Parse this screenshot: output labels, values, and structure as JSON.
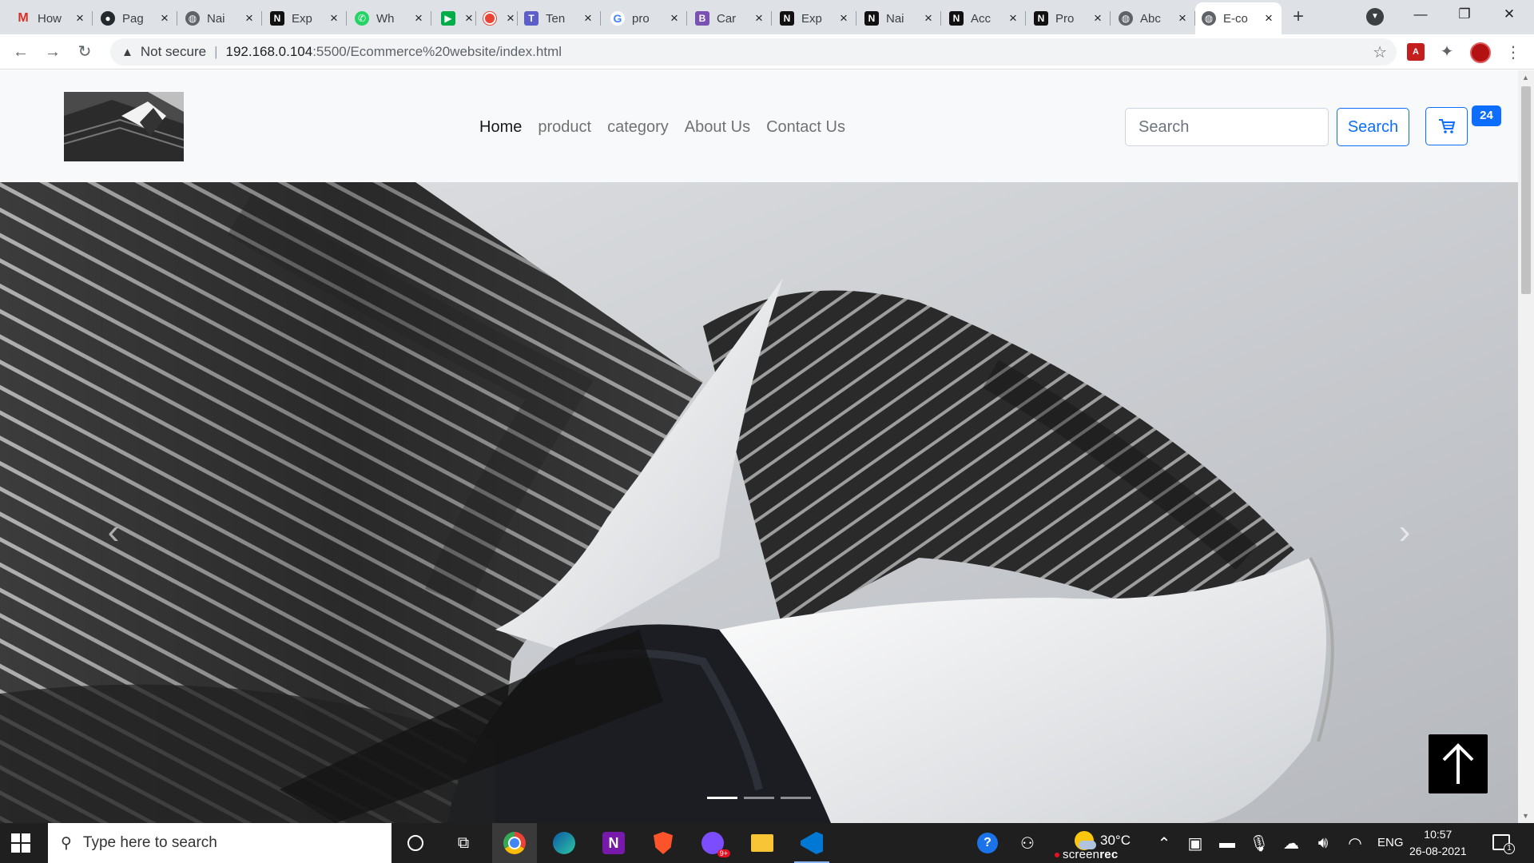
{
  "browser": {
    "tabs": [
      {
        "title": "How",
        "favicon": "gmail-icon"
      },
      {
        "title": "Pag",
        "favicon": "github-icon"
      },
      {
        "title": "Nai",
        "favicon": "globe-icon"
      },
      {
        "title": "Exp",
        "favicon": "np-icon"
      },
      {
        "title": "Wh",
        "favicon": "whatsapp-icon"
      },
      {
        "title": "",
        "favicon": "meet-icon"
      },
      {
        "title": "",
        "favicon": "record-icon"
      },
      {
        "title": "Ten",
        "favicon": "teams-icon"
      },
      {
        "title": "pro",
        "favicon": "google-icon"
      },
      {
        "title": "Car",
        "favicon": "bootstrap-icon"
      },
      {
        "title": "Exp",
        "favicon": "np-icon"
      },
      {
        "title": "Nai",
        "favicon": "np-icon"
      },
      {
        "title": "Acc",
        "favicon": "np-icon"
      },
      {
        "title": "Pro",
        "favicon": "np-icon"
      },
      {
        "title": "Abc",
        "favicon": "globe-icon"
      },
      {
        "title": "E-co",
        "favicon": "globe-icon",
        "active": true
      }
    ],
    "security_label": "Not secure",
    "url_host": "192.168.0.104",
    "url_path": ":5500/Ecommerce%20website/index.html"
  },
  "site": {
    "nav": [
      "Home",
      "product",
      "category",
      "About Us",
      "Contact Us"
    ],
    "active_nav": "Home",
    "search_placeholder": "Search",
    "search_button": "Search",
    "cart_count": "24",
    "carousel_slides": 3,
    "carousel_active": 1
  },
  "taskbar": {
    "search_placeholder": "Type here to search",
    "temperature": "30°C",
    "language": "ENG",
    "time": "10:57",
    "date": "26-08-2021",
    "recorder_label_1": "screen",
    "recorder_label_2": "rec",
    "notification_count": "1"
  }
}
